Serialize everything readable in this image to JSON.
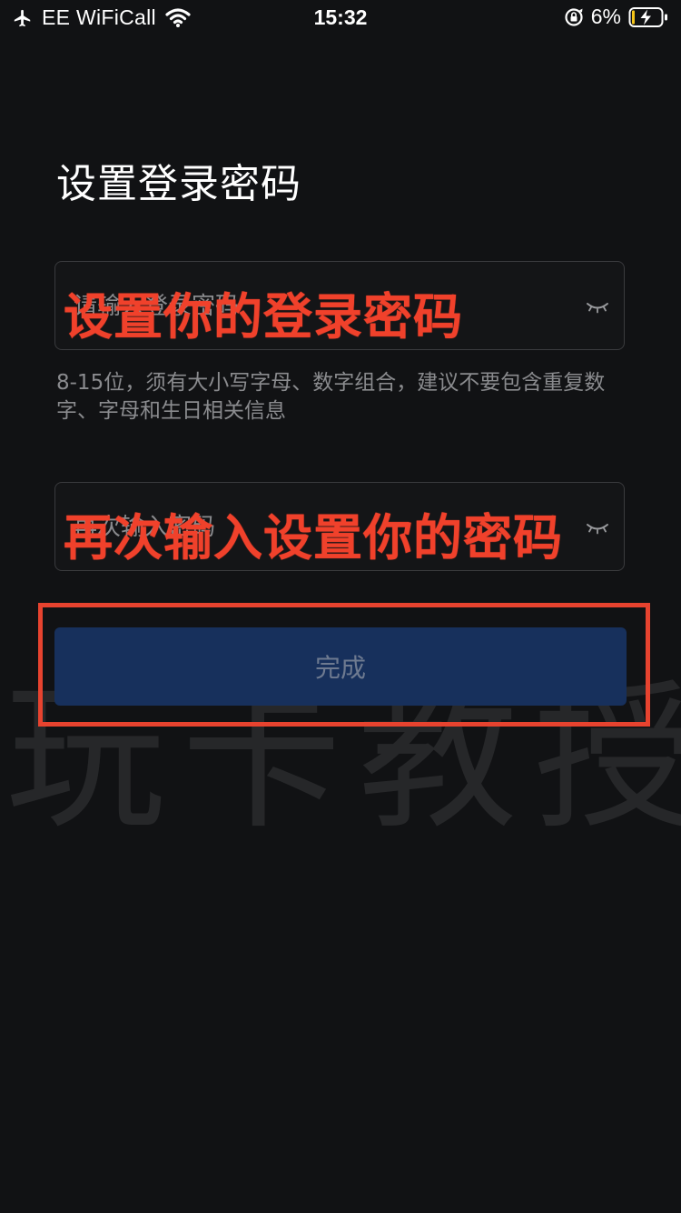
{
  "status_bar": {
    "carrier": "EE WiFiCall",
    "time": "15:32",
    "battery_percent": "6%",
    "icons": [
      "airplane-icon",
      "wifi-icon",
      "orientation-lock-icon",
      "battery-charging-icon"
    ]
  },
  "page": {
    "title": "设置登录密码"
  },
  "form": {
    "password": {
      "placeholder": "请输入登录密码",
      "value": ""
    },
    "hint": "8-15位，须有大小写字母、数字组合，建议不要包含重复数字、字母和生日相关信息",
    "confirm_password": {
      "placeholder": "再次输入密码",
      "value": ""
    },
    "done_label": "完成"
  },
  "annotations": {
    "caption_1": "设置你的登录密码",
    "caption_2": "再次输入设置你的密码",
    "accent_color": "#f0412b"
  },
  "watermark": "玩卡教授",
  "colors": {
    "background": "#111214",
    "button_bg": "#17305c",
    "button_text": "#6e7a90"
  }
}
